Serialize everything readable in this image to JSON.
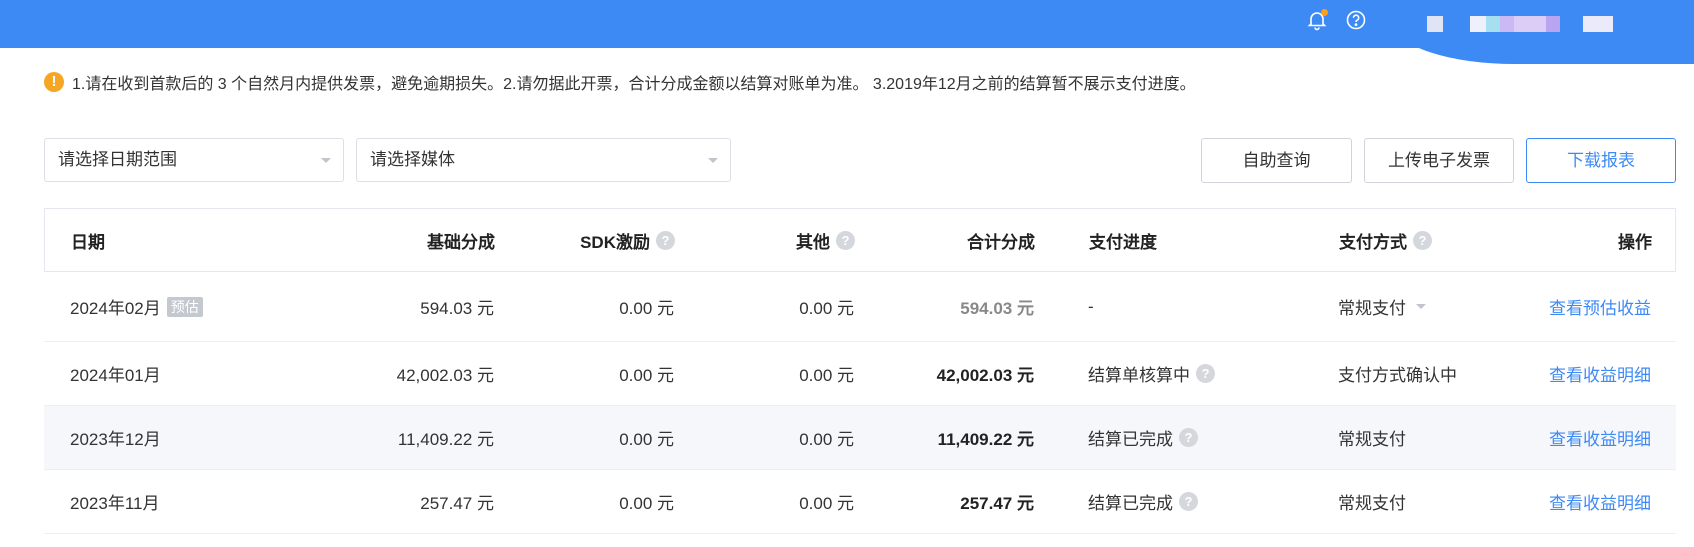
{
  "notice": {
    "text": "1.请在收到首款后的 3 个自然月内提供发票，避免逾期损失。2.请勿据此开票，合计分成金额以结算对账单为准。 3.2019年12月之前的结算暂不展示支付进度。"
  },
  "filters": {
    "date_range_placeholder": "请选择日期范围",
    "media_placeholder": "请选择媒体"
  },
  "buttons": {
    "self_query": "自助查询",
    "upload_invoice": "上传电子发票",
    "download_report": "下载报表"
  },
  "table": {
    "headers": {
      "date": "日期",
      "base_share": "基础分成",
      "sdk_incentive": "SDK激励",
      "other": "其他",
      "total_share": "合计分成",
      "pay_progress": "支付进度",
      "pay_method": "支付方式",
      "action": "操作"
    },
    "rows": [
      {
        "date": "2024年02月",
        "tag": "预估",
        "base": "594.03 元",
        "sdk": "0.00 元",
        "other": "0.00 元",
        "total": "594.03 元",
        "progress": "-",
        "method": "常规支付",
        "action": "查看预估收益"
      },
      {
        "date": "2024年01月",
        "base": "42,002.03 元",
        "sdk": "0.00 元",
        "other": "0.00 元",
        "total": "42,002.03 元",
        "progress": "结算单核算中",
        "method": "支付方式确认中",
        "action": "查看收益明细"
      },
      {
        "date": "2023年12月",
        "base": "11,409.22 元",
        "sdk": "0.00 元",
        "other": "0.00 元",
        "total": "11,409.22 元",
        "progress": "结算已完成",
        "method": "常规支付",
        "action": "查看收益明细"
      },
      {
        "date": "2023年11月",
        "base": "257.47 元",
        "sdk": "0.00 元",
        "other": "0.00 元",
        "total": "257.47 元",
        "progress": "结算已完成",
        "method": "常规支付",
        "action": "查看收益明细"
      }
    ]
  },
  "icons": {
    "bell": "bell-icon",
    "help": "help-circle-icon",
    "warning": "warning-icon",
    "question": "question-icon"
  },
  "colors": {
    "topbar": "#3e8af5",
    "accent": "#3e8af5",
    "warning": "#f5a623",
    "notification_dot": "#ff9f1a"
  }
}
